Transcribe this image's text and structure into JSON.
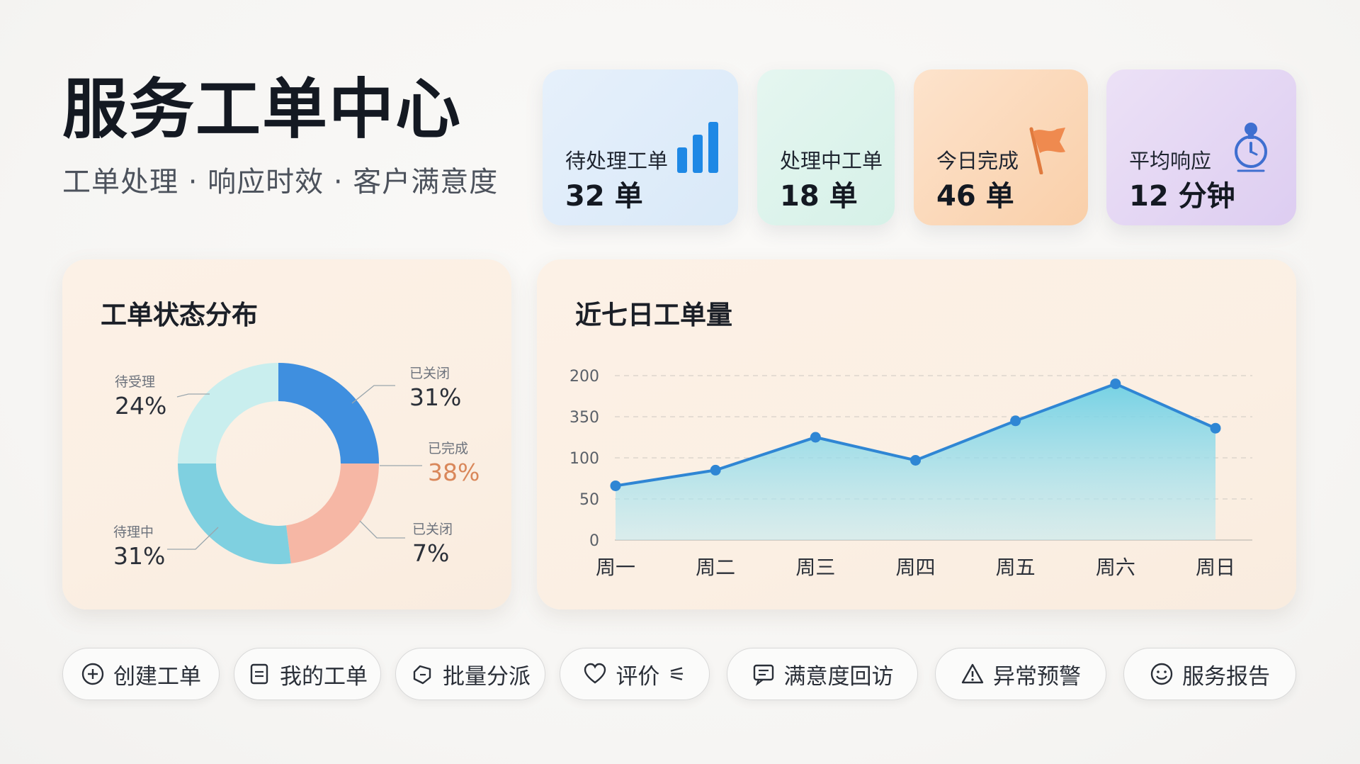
{
  "header": {
    "title": "服务工单中心",
    "subtitle": "工单处理 · 响应时效 · 客户满意度"
  },
  "stats": [
    {
      "label": "待处理工单",
      "value": "32 单",
      "icon": "bar-chart-icon",
      "color": "#1e88e5"
    },
    {
      "label": "处理中工单",
      "value": "18 单",
      "icon": "",
      "color": "#2bb58f"
    },
    {
      "label": "今日完成",
      "value": "46 单",
      "icon": "flag-icon",
      "color": "#ee8a52"
    },
    {
      "label": "平均响应",
      "value": "12 分钟",
      "icon": "stopwatch-icon",
      "color": "#3f6fd0"
    }
  ],
  "donut_panel": {
    "title": "工单状态分布"
  },
  "line_panel": {
    "title": "近七日工单量"
  },
  "chart_data": [
    {
      "type": "pie",
      "donut": true,
      "labels": [
        {
          "name": "已关闭",
          "pct": "31%"
        },
        {
          "name": "已完成",
          "pct": "38%"
        },
        {
          "name": "已关闭",
          "pct": "7%"
        },
        {
          "name": "待理中",
          "pct": "31%"
        },
        {
          "name": "待受理",
          "pct": "24%"
        }
      ],
      "slices": [
        {
          "value": 25,
          "color": "#3f8fdf"
        },
        {
          "value": 23,
          "color": "#f6b7a5"
        },
        {
          "value": 27,
          "color": "#7fd0e0"
        },
        {
          "value": 25,
          "color": "#c9eeee"
        }
      ],
      "legend": "outside-labels"
    },
    {
      "type": "area",
      "categories": [
        "周一",
        "周二",
        "周三",
        "周四",
        "周五",
        "周六",
        "周日"
      ],
      "series": [
        {
          "values": [
            66,
            85,
            125,
            97,
            145,
            190,
            136
          ],
          "color": "#2f86d4"
        }
      ],
      "y_tick_labels": [
        "200",
        "350",
        "100",
        "50",
        "0"
      ],
      "ylim": [
        0,
        200
      ],
      "grid": true
    }
  ],
  "actions": [
    {
      "label": "创建工单",
      "icon": "plus-circle-icon"
    },
    {
      "label": "我的工单",
      "icon": "document-icon"
    },
    {
      "label": "批量分派",
      "icon": "tag-icon"
    },
    {
      "label": "评价",
      "icon": "heart-icon"
    },
    {
      "label": "满意度回访",
      "icon": "message-icon"
    },
    {
      "label": "异常预警",
      "icon": "warning-icon"
    },
    {
      "label": "服务报告",
      "icon": "smile-icon"
    }
  ]
}
